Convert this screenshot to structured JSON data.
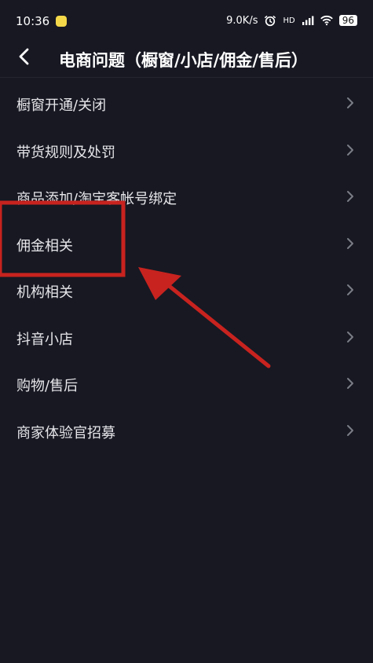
{
  "status": {
    "time": "10:36",
    "speed": "9.0K/s",
    "hd": "HD",
    "battery": "96"
  },
  "header": {
    "title": "电商问题（橱窗/小店/佣金/售后）"
  },
  "list": {
    "items": [
      {
        "label": "橱窗开通/关闭"
      },
      {
        "label": "带货规则及处罚"
      },
      {
        "label": "商品添加/淘宝客帐号绑定"
      },
      {
        "label": "佣金相关"
      },
      {
        "label": "机构相关"
      },
      {
        "label": "抖音小店"
      },
      {
        "label": "购物/售后"
      },
      {
        "label": "商家体验官招募"
      }
    ]
  },
  "annotation": {
    "highlight_color": "#c8231f",
    "arrow_color": "#c8231f"
  },
  "colors": {
    "background": "#171822",
    "text": "#e6e6ea",
    "chevron": "#7b7d86"
  }
}
